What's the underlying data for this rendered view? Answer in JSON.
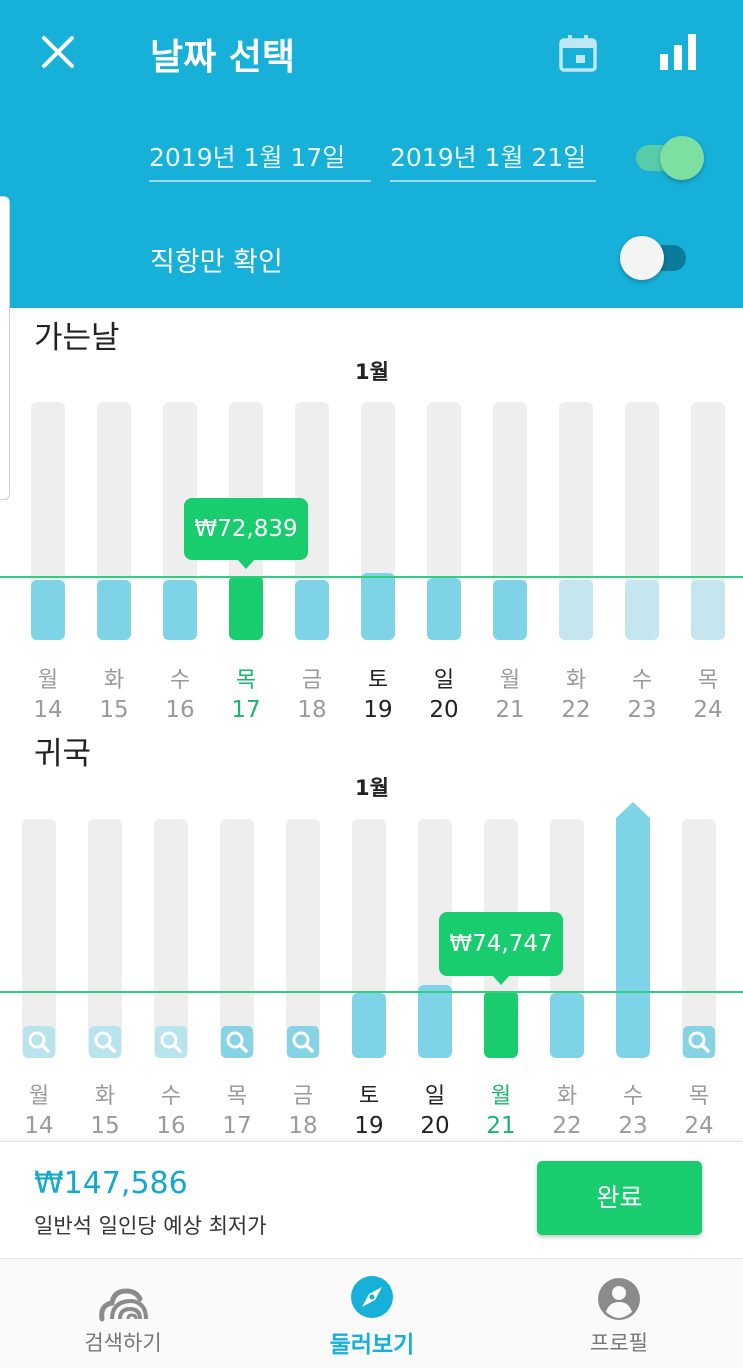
{
  "header": {
    "title": "날짜 선택",
    "start_date": "2019년 1월 17일",
    "end_date": "2019년 1월 21일",
    "direct_only_label": "직항만 확인",
    "colors": {
      "header_bg": "#16b0d8",
      "accent_green": "#19cc6e"
    }
  },
  "outbound": {
    "title": "가는날",
    "month": "1월",
    "selected_price": "₩72,839",
    "days": [
      {
        "weekday": "월",
        "date": "14"
      },
      {
        "weekday": "화",
        "date": "15"
      },
      {
        "weekday": "수",
        "date": "16"
      },
      {
        "weekday": "목",
        "date": "17"
      },
      {
        "weekday": "금",
        "date": "18"
      },
      {
        "weekday": "토",
        "date": "19"
      },
      {
        "weekday": "일",
        "date": "20"
      },
      {
        "weekday": "월",
        "date": "21"
      },
      {
        "weekday": "화",
        "date": "22"
      },
      {
        "weekday": "수",
        "date": "23"
      },
      {
        "weekday": "목",
        "date": "24"
      }
    ]
  },
  "return": {
    "title": "귀국",
    "month": "1월",
    "selected_price": "₩74,747",
    "days": [
      {
        "weekday": "월",
        "date": "14"
      },
      {
        "weekday": "화",
        "date": "15"
      },
      {
        "weekday": "수",
        "date": "16"
      },
      {
        "weekday": "목",
        "date": "17"
      },
      {
        "weekday": "금",
        "date": "18"
      },
      {
        "weekday": "토",
        "date": "19"
      },
      {
        "weekday": "일",
        "date": "20"
      },
      {
        "weekday": "월",
        "date": "21"
      },
      {
        "weekday": "화",
        "date": "22"
      },
      {
        "weekday": "수",
        "date": "23"
      },
      {
        "weekday": "목",
        "date": "24"
      }
    ]
  },
  "summary": {
    "total_price": "₩147,586",
    "price_desc": "일반석 일인당 예상 최저가",
    "done_label": "완료"
  },
  "nav": {
    "items": [
      {
        "label": "검색하기",
        "icon": "cloud-wifi-icon"
      },
      {
        "label": "둘러보기",
        "icon": "compass-icon"
      },
      {
        "label": "프로필",
        "icon": "profile-icon"
      }
    ]
  }
}
